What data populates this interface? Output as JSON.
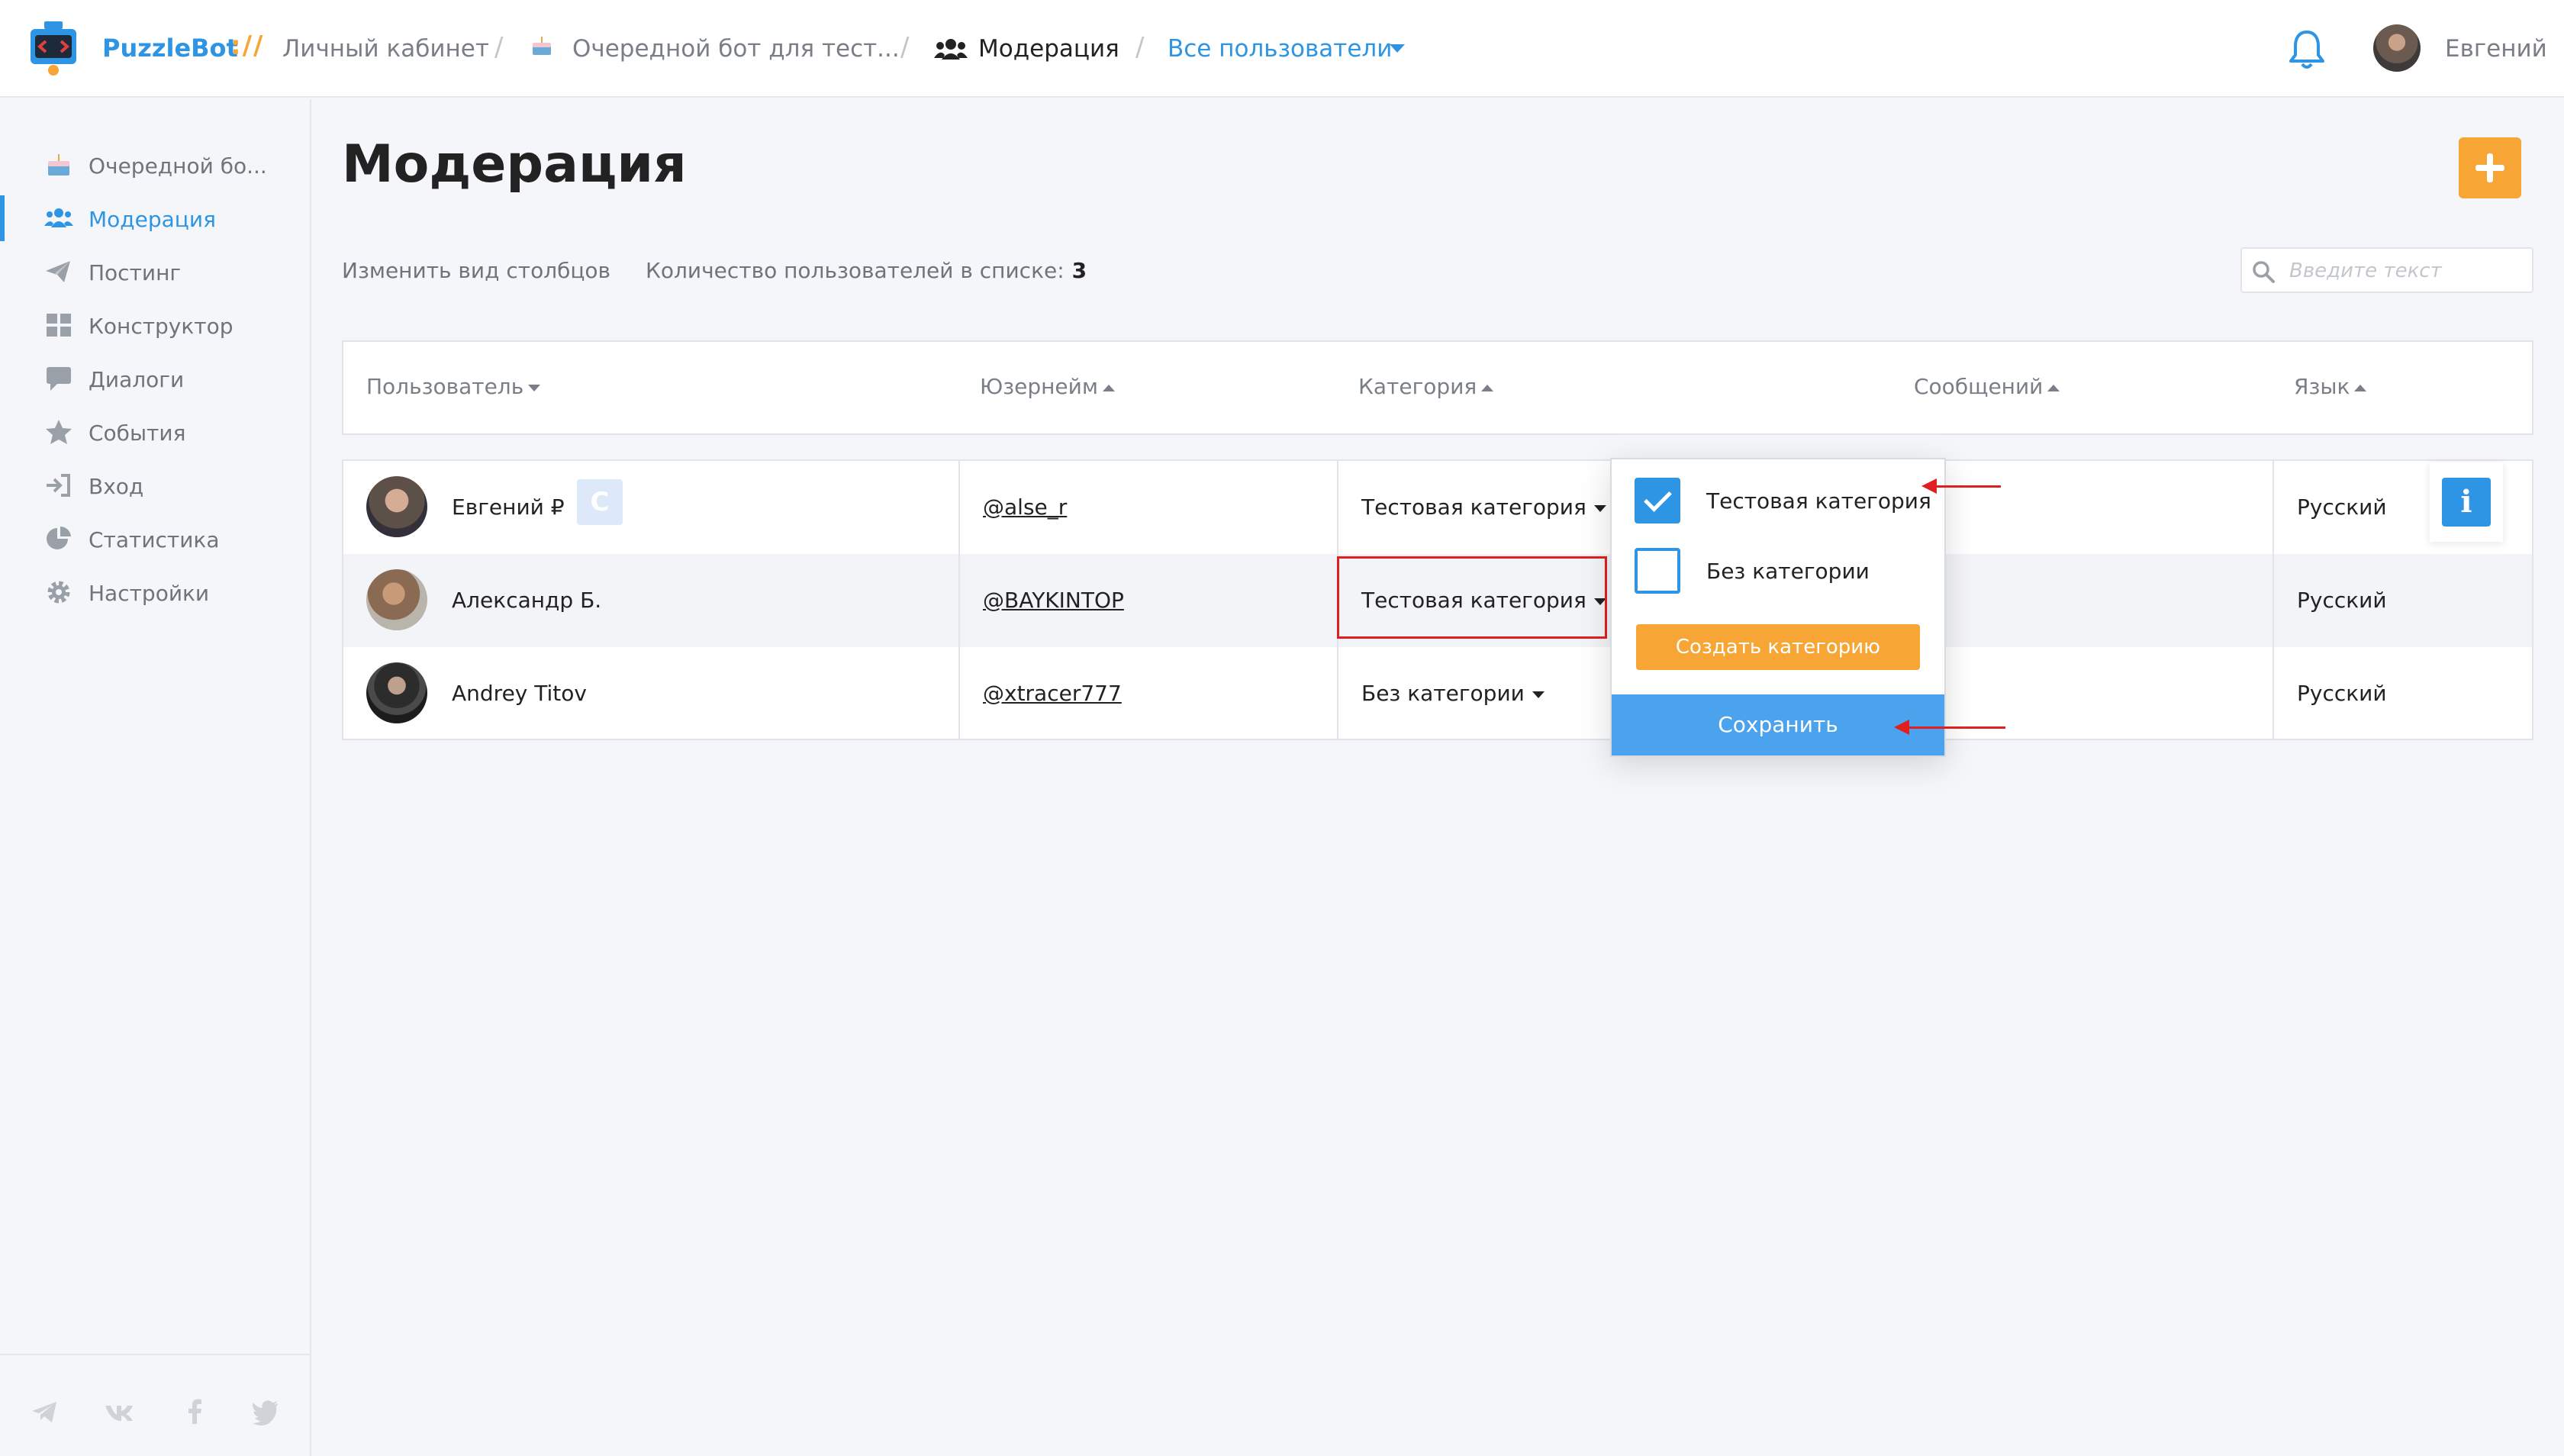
{
  "header": {
    "brand": "PuzzleBot",
    "brand_separator": "://",
    "breadcrumbs": [
      {
        "label": "Личный кабинет"
      },
      {
        "label": "Очередной бот для тест..."
      },
      {
        "label": "Модерация"
      },
      {
        "label": "Все пользователи"
      }
    ],
    "user_name": "Евгений"
  },
  "sidebar": {
    "items": [
      {
        "label": "Очередной бо...",
        "icon": "cake-icon"
      },
      {
        "label": "Модерация",
        "icon": "users-icon",
        "active": true
      },
      {
        "label": "Постинг",
        "icon": "paper-plane-icon"
      },
      {
        "label": "Конструктор",
        "icon": "grid-icon"
      },
      {
        "label": "Диалоги",
        "icon": "chat-icon"
      },
      {
        "label": "События",
        "icon": "star-icon"
      },
      {
        "label": "Вход",
        "icon": "sign-in-icon"
      },
      {
        "label": "Статистика",
        "icon": "pie-chart-icon"
      },
      {
        "label": "Настройки",
        "icon": "gear-icon"
      }
    ],
    "social": [
      "telegram-icon",
      "vk-icon",
      "facebook-icon",
      "twitter-icon"
    ]
  },
  "main": {
    "title": "Модерация",
    "change_columns": "Изменить вид столбцов",
    "count_label": "Количество пользователей в списке:",
    "count_value": "3",
    "search_placeholder": "Введите текст",
    "columns": [
      "Пользователь",
      "Юзернейм",
      "Категория",
      "Сообщений",
      "Язык"
    ],
    "rows": [
      {
        "name": "Евгений ₽",
        "badge": "C",
        "username": "@alse_r",
        "category": "Тестовая категория",
        "language": "Русский"
      },
      {
        "name": "Александр Б.",
        "username": "@BAYKINTOP",
        "category": "Тестовая категория",
        "language": "Русский"
      },
      {
        "name": "Andrey Titov",
        "username": "@xtracer777",
        "category": "Без категории",
        "language": "Русский"
      }
    ],
    "info_button": "i"
  },
  "popup": {
    "options": [
      {
        "label": "Тестовая категория",
        "checked": true
      },
      {
        "label": "Без категории",
        "checked": false
      }
    ],
    "create_label": "Создать категорию",
    "save_label": "Сохранить"
  },
  "colors": {
    "accent_blue": "#2d95e3",
    "accent_orange": "#f7a534",
    "annotation_red": "#e02020"
  }
}
